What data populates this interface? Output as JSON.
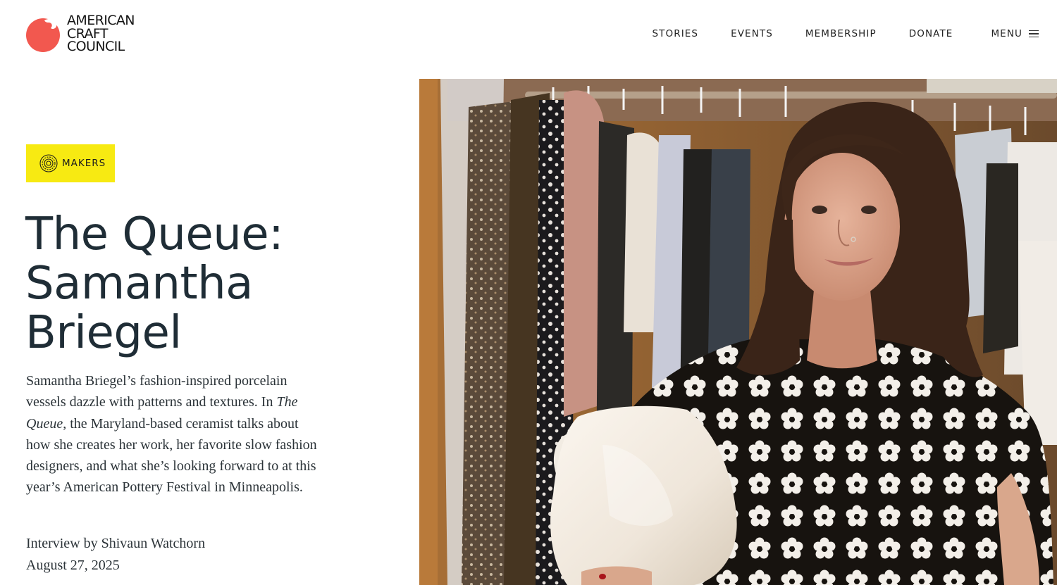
{
  "header": {
    "logo": {
      "lines": [
        "AMERICAN",
        "CRAFT",
        "COUNCIL"
      ],
      "mark_color": "#f2584f"
    },
    "nav": [
      {
        "label": "STORIES"
      },
      {
        "label": "EVENTS"
      },
      {
        "label": "MEMBERSHIP"
      },
      {
        "label": "DONATE"
      }
    ],
    "menu_label": "MENU"
  },
  "article": {
    "category": {
      "label": "MAKERS",
      "color": "#f7ea12",
      "icon": "target-icon"
    },
    "title_lines": [
      "The Queue:",
      "Samantha",
      "Briegel"
    ],
    "intro": {
      "part1": "Samantha Briegel’s fashion-inspired porcelain vessels dazzle with patterns and textures. In ",
      "italic": "The Queue",
      "part2": ", the Maryland-based ceramist talks about how she creates her work, her favorite slow fashion designers, and what she’s looking forward to at this year’s American Pottery Festival in Minneapolis."
    },
    "byline": "Interview by Shivaun Watchorn",
    "date": "August 27, 2025"
  }
}
